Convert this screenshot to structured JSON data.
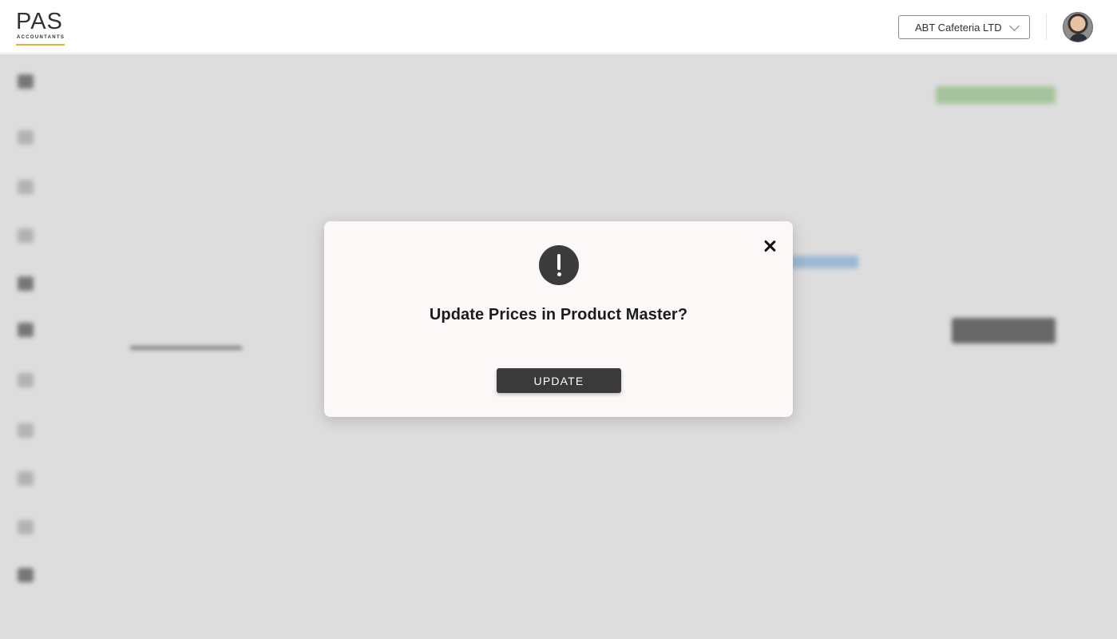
{
  "header": {
    "logo_text": "PAS",
    "logo_subtext": "ACCOUNTANTS",
    "company_selector": {
      "selected": "ABT Cafeteria LTD",
      "icon": "chevron-down-icon"
    },
    "avatar_icon": "user-avatar"
  },
  "background_page": {
    "note_blurred": true,
    "title": "",
    "sidebar_icons": [
      "dashboard-icon",
      "home-icon",
      "list-icon",
      "chart-icon",
      "box-icon",
      "truck-icon",
      "document-icon",
      "user-icon",
      "settings-icon",
      "help-icon",
      "logout-icon"
    ],
    "fields_left": [
      {
        "label": "",
        "value": ""
      },
      {
        "label": "",
        "value": ""
      },
      {
        "label": "",
        "value": ""
      },
      {
        "label": "",
        "value": ""
      }
    ],
    "fields_right": [
      {
        "label": "",
        "value": ""
      },
      {
        "label": "",
        "value": ""
      },
      {
        "label": "",
        "value": ""
      }
    ],
    "tabs": [
      {
        "label": ""
      },
      {
        "label": ""
      }
    ],
    "table": {
      "headers": [
        "",
        "",
        "",
        "",
        ""
      ],
      "rows": [
        [
          "",
          "",
          "",
          "",
          ""
        ],
        [
          "",
          "",
          "",
          "",
          ""
        ],
        [
          "",
          "",
          "",
          "",
          ""
        ]
      ]
    }
  },
  "modal": {
    "icon": "exclamation-icon",
    "title": "Update Prices in Product Master?",
    "confirm_label": "UPDATE",
    "close_icon": "close-icon"
  },
  "colors": {
    "overlay": "#000000",
    "modal_bg": "#fcf8f8",
    "button_bg": "#3a3a3a",
    "logo_accent": "#e7b431"
  }
}
